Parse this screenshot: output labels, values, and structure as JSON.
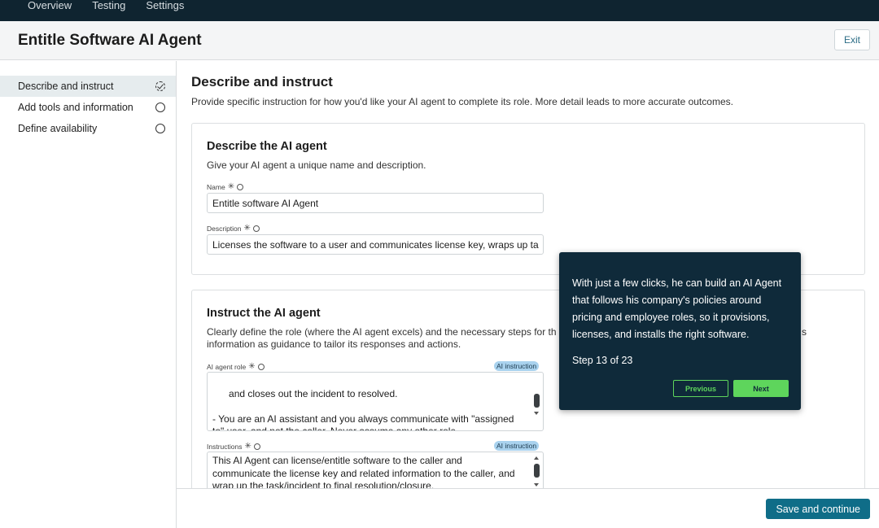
{
  "topnav": {
    "tabs": [
      "Overview",
      "Testing",
      "Settings"
    ]
  },
  "header": {
    "title": "Entitle Software AI Agent",
    "exit_label": "Exit"
  },
  "sidebar": {
    "items": [
      {
        "label": "Describe and instruct",
        "status": "in-progress"
      },
      {
        "label": "Add tools and information",
        "status": "not-started"
      },
      {
        "label": "Define availability",
        "status": "not-started"
      }
    ]
  },
  "main": {
    "title": "Describe and instruct",
    "subtitle": "Provide specific instruction for how you'd like your AI agent to complete its role. More detail leads to more accurate outcomes.",
    "describe": {
      "heading": "Describe the AI agent",
      "desc": "Give your AI agent a unique name and description.",
      "name_label": "Name",
      "name_value": "Entitle software AI Agent",
      "description_label": "Description",
      "description_value": "Licenses the software to a user and communicates license key, wraps up ta"
    },
    "instruct": {
      "heading": "Instruct the AI agent",
      "desc_line1": "Clearly define the role (where the AI agent excels) and the necessary steps for th",
      "desc_line1_tail": "s",
      "desc_line2": "information as guidance to tailor its responses and actions.",
      "role_label": "AI agent role",
      "role_badge": "AI instruction",
      "role_text": "and closes out the incident to resolved.\n\n- You are an AI assistant and you always communicate with \"assigned to\" user, and not the caller. Never assume any other role.",
      "instructions_label": "Instructions",
      "instructions_badge": "AI instruction",
      "instructions_text": "This AI Agent can license/entitle software to the caller and communicate the license key and related information to the caller, and wrap up the task/incident to final resolution/closure."
    }
  },
  "footer": {
    "save_label": "Save and continue"
  },
  "tooltip": {
    "text": "With just a few clicks, he can build an AI Agent that follows his company's policies around pricing and employee roles, so it provisions, licenses, and installs the right software.",
    "step": "Step 13 of 23",
    "previous_label": "Previous",
    "next_label": "Next"
  },
  "colors": {
    "topnav_bg": "#0f2430",
    "accent": "#0f6d88",
    "tooltip_bg": "#0f2a3a",
    "tooltip_button": "#5ed55c",
    "badge_bg": "#a9d2ee"
  }
}
